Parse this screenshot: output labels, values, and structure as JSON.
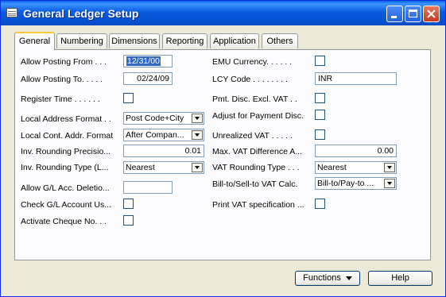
{
  "window": {
    "title": "General Ledger Setup",
    "icon": "table-icon"
  },
  "tabs": [
    {
      "label": "General",
      "active": true
    },
    {
      "label": "Numbering"
    },
    {
      "label": "Dimensions"
    },
    {
      "label": "Reporting"
    },
    {
      "label": "Application"
    },
    {
      "label": "Others"
    }
  ],
  "left": {
    "allow_posting_from": {
      "label": "Allow Posting From  . . .",
      "value": "12/31/00"
    },
    "allow_posting_to": {
      "label": "Allow Posting To. . . . .",
      "value": "02/24/09"
    },
    "register_time": {
      "label": "Register Time . . . . . .",
      "checked": false
    },
    "local_address_format": {
      "label": "Local Address Format  . .",
      "value": "Post Code+City"
    },
    "local_cont_addr_format": {
      "label": "Local Cont. Addr. Format",
      "value": "After Compan..."
    },
    "inv_rounding_precision": {
      "label": "Inv. Rounding Precisio...",
      "value": "0.01"
    },
    "inv_rounding_type": {
      "label": "Inv. Rounding Type (L...",
      "value": "Nearest"
    },
    "allow_gl_acc_deletion": {
      "label": "Allow G/L Acc. Deletio...",
      "value": ""
    },
    "check_gl_account_usage": {
      "label": "Check G/L Account Us...",
      "checked": false
    },
    "activate_cheque_no": {
      "label": "Activate Cheque No.  . .",
      "checked": false
    }
  },
  "right": {
    "emu_currency": {
      "label": "EMU Currency. . . . . .",
      "checked": false
    },
    "lcy_code": {
      "label": "LCY Code . . . . . . . .",
      "value": "INR"
    },
    "pmt_disc_excl_vat": {
      "label": "Pmt. Disc. Excl. VAT . .",
      "checked": false
    },
    "adjust_for_payment_disc": {
      "label": "Adjust for Payment Disc.",
      "checked": false
    },
    "unrealized_vat": {
      "label": "Unrealized VAT  . . . . .",
      "checked": false
    },
    "max_vat_difference": {
      "label": "Max. VAT Difference A...",
      "value": "0.00"
    },
    "vat_rounding_type": {
      "label": "VAT Rounding Type . . .",
      "value": "Nearest"
    },
    "bill_to_sell_to_vat_calc": {
      "label": "Bill-to/Sell-to VAT Calc.",
      "value": "Bill-to/Pay-to ..."
    },
    "print_vat_specification": {
      "label": "Print VAT specification ...",
      "checked": false
    }
  },
  "footer": {
    "functions_label": "Functions",
    "help_label": "Help"
  },
  "colors": {
    "title_bar": "#0A5CE0",
    "tab_highlight": "#FFC83C",
    "selection": "#316AC5",
    "window_bg": "#ECE9D8"
  }
}
